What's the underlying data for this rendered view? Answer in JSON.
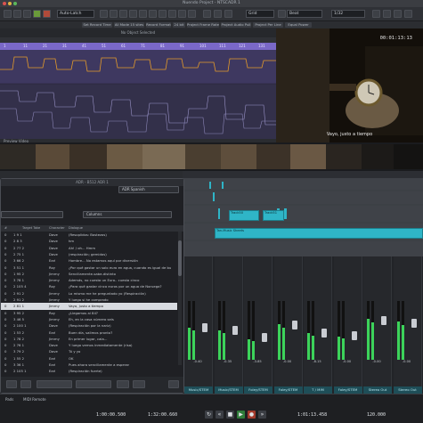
{
  "window": {
    "title": "Nuendo Project - NTSCADR 1"
  },
  "toolbar": {
    "auto_latch": "Auto-Latch",
    "grid": "Grid",
    "quantize_label": "Beat",
    "quantize_value": "1/32"
  },
  "info_line": [
    "Set Record Time",
    "All Mode 15 sites",
    "Record Format",
    "24 bit",
    "Project Frame Rate",
    "Project Audio Pull",
    "Project Per Line",
    "Equal Power"
  ],
  "project_header": "No Object Selected",
  "ruler_marks": [
    "1",
    "11",
    "21",
    "31",
    "41",
    "51",
    "61",
    "71",
    "81",
    "91",
    "101",
    "111",
    "121",
    "131"
  ],
  "preview_label": "Preview Video",
  "video": {
    "timecode": "00:01:13:13",
    "subtitle": "Vayo, justo a tiempo"
  },
  "track_clips": [
    {
      "label": "Track50"
    },
    {
      "label": "Track51"
    },
    {
      "label": "Tan-Music Sheets"
    }
  ],
  "adr_panel": {
    "header": "ADR - B512 ADR 1",
    "language": "ADR Spanish",
    "columns_label": "Columns",
    "columns": [
      "#",
      "Target Take",
      "Character",
      "Dialogue"
    ],
    "rows": [
      {
        "num": "0",
        "take": "1 9 1",
        "char": "Dave",
        "text": "(Resoplidos: Bostezos)"
      },
      {
        "num": "0",
        "take": "2 8 3",
        "char": "Dave",
        "text": "hm"
      },
      {
        "num": "0",
        "take": "2 77 2",
        "char": "Dave",
        "text": "Ah! / oh... Hmm"
      },
      {
        "num": "0",
        "take": "2 75 1",
        "char": "Dave",
        "text": "(respiración; gemidos)"
      },
      {
        "num": "0",
        "take": "3 66 2",
        "char": "Earl",
        "text": "Hombre... No estamos aquí por diversión"
      },
      {
        "num": "0",
        "take": "3 51 1",
        "char": "Roy",
        "text": "¿Por qué gastar un solo euro en agua, cuando es igual de bu"
      },
      {
        "num": "0",
        "take": "1 95 2",
        "char": "Jimmy",
        "text": "Sencillamente-sabe-distinto"
      },
      {
        "num": "0",
        "take": "3 78 1",
        "char": "Jimmy",
        "text": "Además, no cuesta un Euro.. cuesta cinco"
      },
      {
        "num": "0",
        "take": "2 105 4",
        "char": "Roy",
        "text": "¿Para qué gastar cinco euros por un agua de Noruega?"
      },
      {
        "num": "0",
        "take": "2 91 2",
        "char": "Jimmy",
        "text": "Lo mismo me he preguntado yo (Respiración)"
      },
      {
        "num": "0",
        "take": "2 91 2",
        "char": "Jimmy",
        "text": "Y luego si he comprado"
      },
      {
        "num": "0",
        "take": "2 81 1",
        "char": "Jimmy",
        "text": "Vaya, justo a tiempo"
      },
      {
        "num": "0",
        "take": "3 95 2",
        "char": "Roy",
        "text": "¿Llegamos al 84?"
      },
      {
        "num": "0",
        "take": "3 46 5",
        "char": "Jimmy",
        "text": "Eh, en la casa número seis"
      },
      {
        "num": "0",
        "take": "2 100 1",
        "char": "Dave",
        "text": "(Respiración por la nariz)"
      },
      {
        "num": "0",
        "take": "1 53 2",
        "char": "Earl",
        "text": "Buen día, salimos pronto?"
      },
      {
        "num": "0",
        "take": "1 78 2",
        "char": "Jimmy",
        "text": "En primer lugar, cala..."
      },
      {
        "num": "0",
        "take": "2 76 1",
        "char": "Dave",
        "text": "Y luego vemos inmediatamente (risa)"
      },
      {
        "num": "0",
        "take": "3 79 2",
        "char": "Dave",
        "text": "Tú y yo"
      },
      {
        "num": "0",
        "take": "1 55 2",
        "char": "Earl",
        "text": "OK"
      },
      {
        "num": "0",
        "take": "3 36 1",
        "char": "Earl",
        "text": "Pues ahora sencillamente a esperar"
      },
      {
        "num": "0",
        "take": "2 105 1",
        "char": "Earl",
        "text": "(Respiración fuerte)"
      }
    ],
    "selected_row": 11
  },
  "mixer": {
    "strips": [
      {
        "label": "Music/STEM",
        "db": "-0.40",
        "level": 0.55
      },
      {
        "label": "Music/STEM",
        "db": "-0.35",
        "level": 0.5
      },
      {
        "label": "Foley/STEM",
        "db": "-3.85",
        "level": 0.35
      },
      {
        "label": "Foley/STEM",
        "db": "-0.00",
        "level": 0.6
      },
      {
        "label": "T / MIM",
        "db": "-8.15",
        "level": 0.45
      },
      {
        "label": "Foley/STEM",
        "db": "-0.00",
        "level": 0.4
      },
      {
        "label": "Stereo Out",
        "db": "-0.00",
        "level": 0.7
      },
      {
        "label": "Stereo Out",
        "db": "-0.00",
        "level": 0.65
      }
    ]
  },
  "transport": {
    "left_locator": "1:00:00.500",
    "right_locator": "1:32:00.660",
    "position": "1:01:13.458",
    "tempo": "120.000",
    "bottom_tabs": [
      "Pads",
      "MIDI Remote"
    ]
  },
  "colors": {
    "accent": "#7a68c8",
    "clip": "#2fb5c7",
    "meter": "#3cd35a"
  }
}
